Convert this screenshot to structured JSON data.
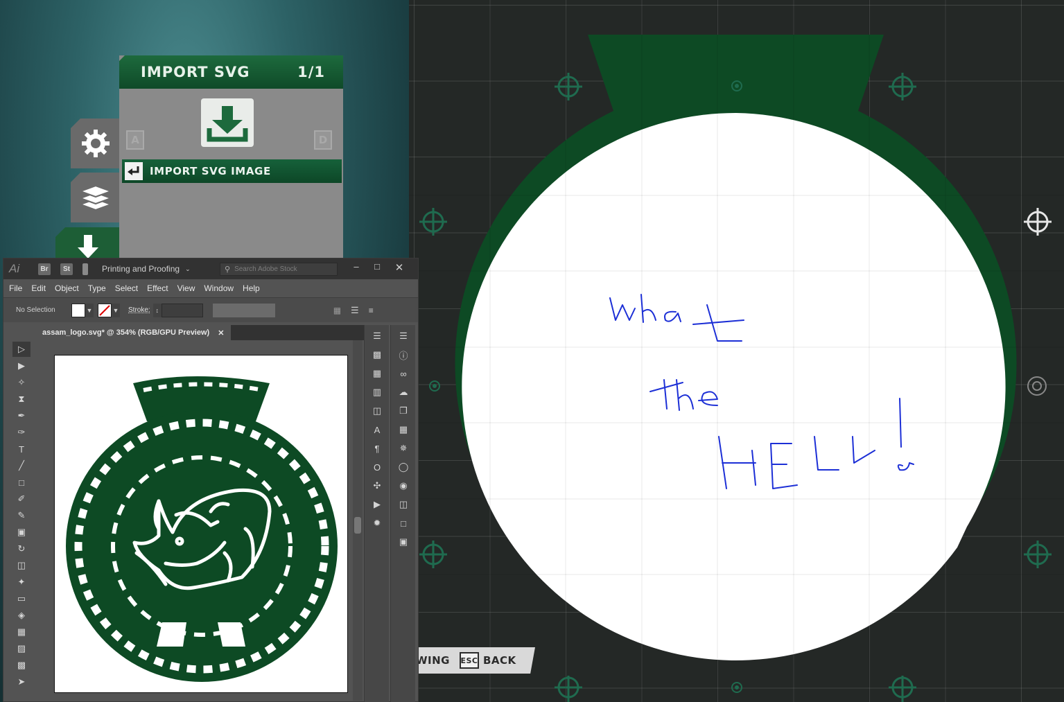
{
  "editor": {
    "handwriting": [
      "what",
      "the",
      "HELL!"
    ],
    "colors": {
      "ring": "#0d4a24",
      "ink": "#1c2fd6",
      "grid_bg": "#242826"
    }
  },
  "import_panel": {
    "title": "IMPORT SVG",
    "counter": "1/1",
    "key_left": "A",
    "key_right": "D",
    "action_label": "IMPORT SVG IMAGE",
    "icons": [
      "download-icon",
      "gear-icon",
      "layers-icon",
      "enter-key-icon"
    ]
  },
  "hint_bar": {
    "partial_label": "WING",
    "esc_key": "ESC",
    "back_label": "BACK"
  },
  "illustrator": {
    "logo": "Ai",
    "chips": [
      "Br",
      "St"
    ],
    "workspace": "Printing and Proofing",
    "search_placeholder": "Search Adobe Stock",
    "menu": [
      "File",
      "Edit",
      "Object",
      "Type",
      "Select",
      "Effect",
      "View",
      "Window",
      "Help"
    ],
    "control": {
      "selection": "No Selection",
      "stroke_label": "Stroke:"
    },
    "document_tab": "assam_logo.svg* @ 354% (RGB/GPU Preview)",
    "tools": [
      "selection-tool",
      "direct-selection-tool",
      "magic-wand-tool",
      "lasso-tool",
      "pen-tool",
      "curvature-tool",
      "type-tool",
      "line-tool",
      "rectangle-tool",
      "paintbrush-tool",
      "pencil-tool",
      "eraser-tool",
      "rotate-tool",
      "scale-tool",
      "puppet-warp-tool",
      "free-transform-tool",
      "shape-builder-tool",
      "perspective-grid-tool",
      "mesh-tool",
      "gradient-tool",
      "eyedropper-tool"
    ],
    "colors": {
      "logo_green": "#0d4a24"
    }
  }
}
